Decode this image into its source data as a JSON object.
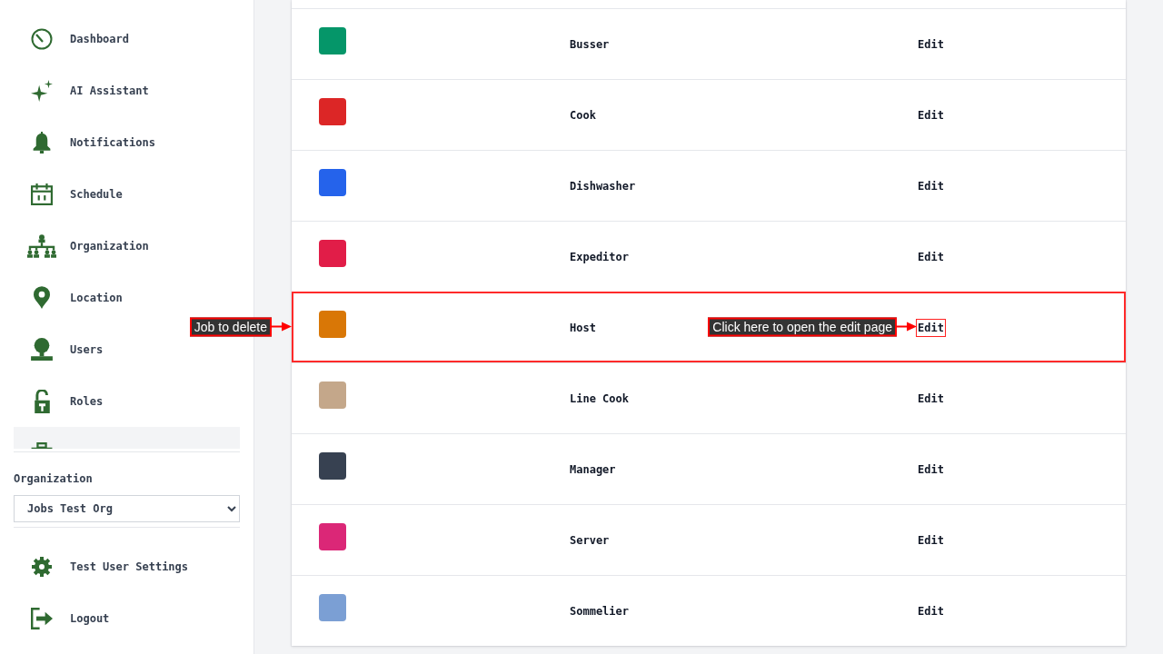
{
  "sidebar": {
    "nav_items": [
      {
        "label": "Dashboard",
        "selected": false
      },
      {
        "label": "AI Assistant",
        "selected": false
      },
      {
        "label": "Notifications",
        "selected": false
      },
      {
        "label": "Schedule",
        "selected": false
      },
      {
        "label": "Organization",
        "selected": false
      },
      {
        "label": "Location",
        "selected": false
      },
      {
        "label": "Users",
        "selected": false
      },
      {
        "label": "Roles",
        "selected": false
      },
      {
        "selected": true
      }
    ],
    "organization": {
      "label": "Organization",
      "value": "Jobs Test Org"
    },
    "footer_items": [
      {
        "label": "Test User Settings"
      },
      {
        "label": "Logout"
      }
    ]
  },
  "jobs_table": {
    "rows": [
      {
        "name": "Busser",
        "color": "#059669",
        "action": "Edit",
        "highlighted": false
      },
      {
        "name": "Cook",
        "color": "#dc2626",
        "action": "Edit",
        "highlighted": false
      },
      {
        "name": "Dishwasher",
        "color": "#2563eb",
        "action": "Edit",
        "highlighted": false
      },
      {
        "name": "Expeditor",
        "color": "#e11d48",
        "action": "Edit",
        "highlighted": false
      },
      {
        "name": "Host",
        "color": "#d97706",
        "action": "Edit",
        "highlighted": true
      },
      {
        "name": "Line Cook",
        "color": "#c4a78a",
        "action": "Edit",
        "highlighted": false
      },
      {
        "name": "Manager",
        "color": "#374151",
        "action": "Edit",
        "highlighted": false
      },
      {
        "name": "Server",
        "color": "#db2777",
        "action": "Edit",
        "highlighted": false
      },
      {
        "name": "Sommelier",
        "color": "#7b9fd4",
        "action": "Edit",
        "highlighted": false
      }
    ]
  },
  "annotations": [
    {
      "kind": "row",
      "text": "Job to delete"
    },
    {
      "kind": "action",
      "text": "Click here to open the edit page"
    }
  ]
}
